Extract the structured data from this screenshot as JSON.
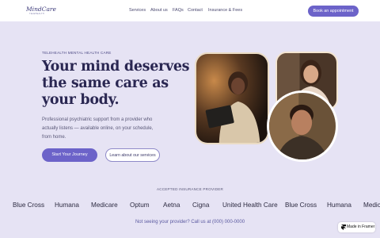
{
  "nav": {
    "logo_text": "MindCare",
    "logo_sub": "TELEHEALTH",
    "links": [
      "Services",
      "About us",
      "FAQs",
      "Contact",
      "Insurance & Fees"
    ],
    "cta": "Book an appointment"
  },
  "hero": {
    "eyebrow": "TELEHEALTH MENTAL HEALTH CARE",
    "headline_lines": [
      "Your mind deserves",
      "the same care as",
      "your body."
    ],
    "subtext_lines": [
      "Professional psychiatric support from a  provider who",
      "actually listens — available  online, on your schedule,",
      "from home."
    ],
    "primary_button": "Start Your Journey",
    "secondary_button": "Learn about our services"
  },
  "insurance": {
    "label": "ACCEPTED INSURANCE PROVIDER",
    "providers": [
      "Blue Cross",
      "Humana",
      "Medicare",
      "Optum",
      "Aetna",
      "Cigna",
      "United Health Care",
      "Blue Cross",
      "Humana",
      "Medica"
    ]
  },
  "footer_note": "Not seeing your provider? Call us at (000) 000-0000",
  "badge": {
    "label": "Made in Framer",
    "icon": "framer-icon"
  },
  "colors": {
    "background": "#e6e3f4",
    "accent": "#6c63c9",
    "headline": "#2a2752"
  }
}
